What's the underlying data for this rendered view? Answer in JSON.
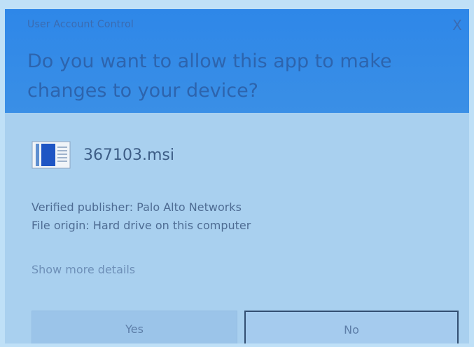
{
  "window": {
    "title": "User Account Control",
    "close_label": "X"
  },
  "prompt": {
    "question": "Do you want to allow this app to make changes to your device?"
  },
  "app": {
    "icon": "msi-installer-icon",
    "name": "367103.msi"
  },
  "info": {
    "publisher": "Verified publisher: Palo Alto Networks",
    "origin": "File origin: Hard drive on this computer"
  },
  "details_link": "Show more details",
  "buttons": {
    "yes": "Yes",
    "no": "No"
  },
  "colors": {
    "header": "#2e87e8",
    "body": "#a9d0ef",
    "no_border": "#334f72"
  }
}
